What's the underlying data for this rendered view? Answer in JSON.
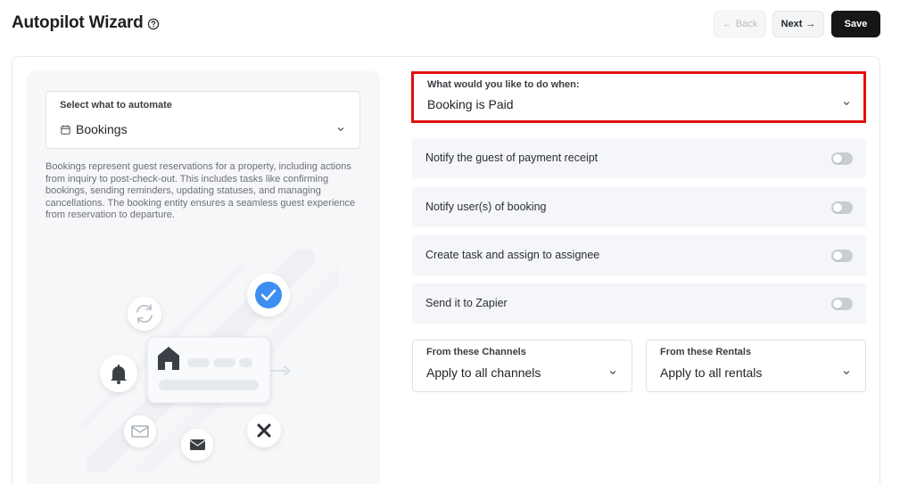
{
  "header": {
    "title": "Autopilot Wizard",
    "help_icon": "question-circle-icon",
    "back_label": "Back",
    "next_label": "Next",
    "save_label": "Save"
  },
  "entity_select": {
    "label": "Select what to automate",
    "value": "Bookings",
    "icon": "calendar-icon",
    "description": "Bookings represent guest reservations for a property, including actions from inquiry to post-check-out. This includes tasks like confirming bookings, sending reminders, updating statuses, and managing cancellations. The booking entity ensures a seamless guest experience from reservation to departure."
  },
  "trigger": {
    "label": "What would you like to do when:",
    "value": "Booking is Paid"
  },
  "actions": [
    {
      "label": "Notify the guest of payment receipt",
      "enabled": false
    },
    {
      "label": "Notify user(s) of booking",
      "enabled": false
    },
    {
      "label": "Create task and assign to assignee",
      "enabled": false
    },
    {
      "label": "Send it to Zapier",
      "enabled": false
    }
  ],
  "channels": {
    "label": "From these Channels",
    "value": "Apply to all channels"
  },
  "rentals": {
    "label": "From these Rentals",
    "value": "Apply to all rentals"
  },
  "colors": {
    "highlight": "#e01010",
    "save_bg": "#161616",
    "check_blue": "#3d8ef0"
  }
}
